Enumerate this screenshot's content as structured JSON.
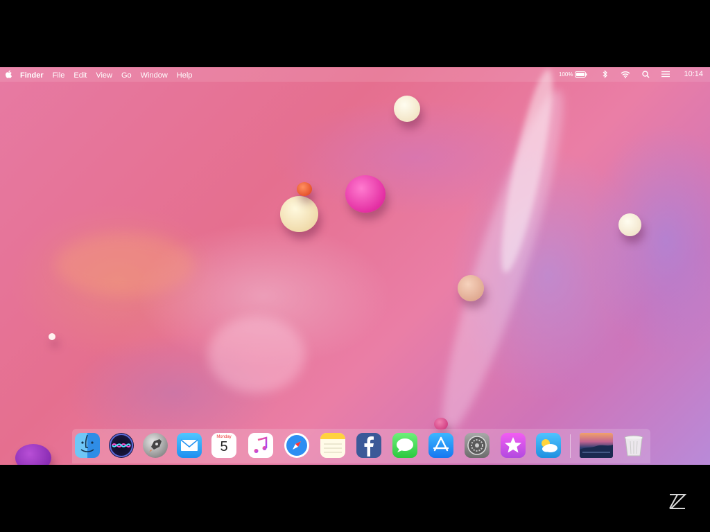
{
  "menubar": {
    "app_name": "Finder",
    "menus": [
      "File",
      "Edit",
      "View",
      "Go",
      "Window",
      "Help"
    ],
    "battery": "100%",
    "clock": "10:14"
  },
  "dock": {
    "items": [
      "finder-icon",
      "siri-icon",
      "launchpad-icon",
      "mail-icon",
      "calendar-icon",
      "music-icon",
      "safari-icon",
      "notes-icon",
      "facebook-icon",
      "messages-icon",
      "app-store-icon",
      "system-preferences-icon",
      "itunes-store-icon",
      "weather-icon",
      "desktop-image-icon",
      "trash-icon"
    ],
    "calendar": {
      "day_name": "Monday",
      "day_number": "5"
    }
  },
  "colors": {
    "wallpaper_base": "#e77aa3",
    "dock_bg": "rgba(255,255,255,0.16)",
    "menubar_text": "#ffffff"
  }
}
